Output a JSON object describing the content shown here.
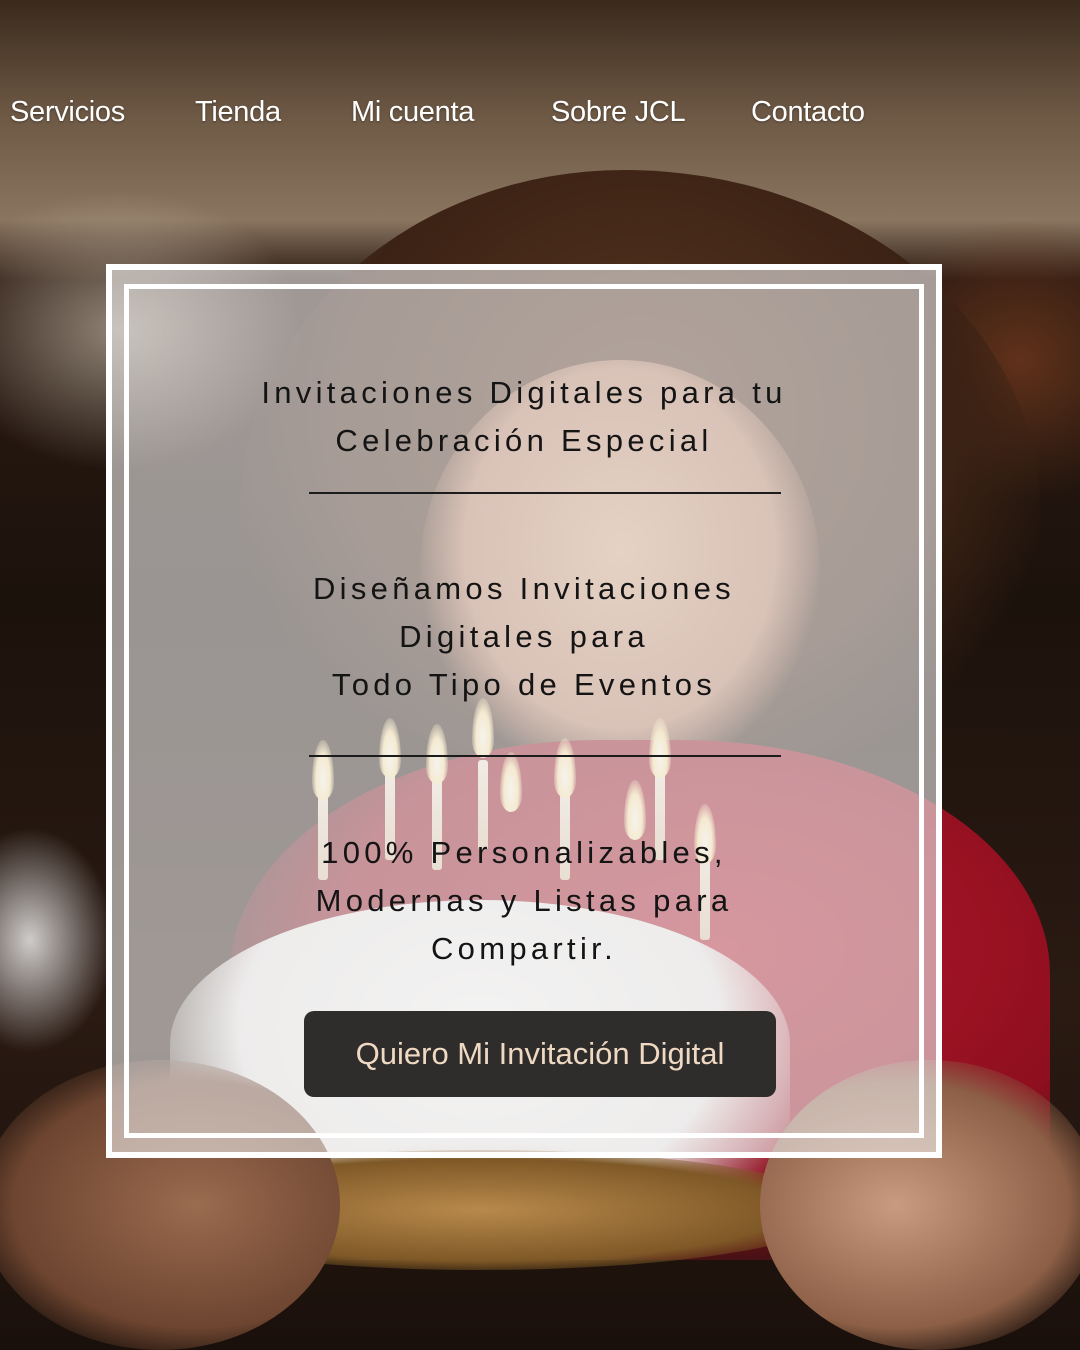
{
  "nav": {
    "items": [
      {
        "label": "Servicios"
      },
      {
        "label": "Tienda"
      },
      {
        "label": "Mi cuenta"
      },
      {
        "label": "Sobre JCL"
      },
      {
        "label": "Contacto"
      }
    ]
  },
  "hero": {
    "title_line1": "Invitaciones Digitales para tu",
    "title_line2": "Celebración Especial",
    "subtitle_line1": "Diseñamos Invitaciones",
    "subtitle_line2": "Digitales para",
    "subtitle_line3": "Todo Tipo de Eventos",
    "feature_line1": "100% Personalizables,",
    "feature_line2": "Modernas y Listas para",
    "feature_line3": "Compartir.",
    "cta_label": "Quiero Mi Invitación Digital"
  },
  "colors": {
    "overlay": "#eeecec",
    "cta_background": "#2f2d2c",
    "cta_text": "#efd9c2",
    "nav_text": "#ffffff"
  }
}
